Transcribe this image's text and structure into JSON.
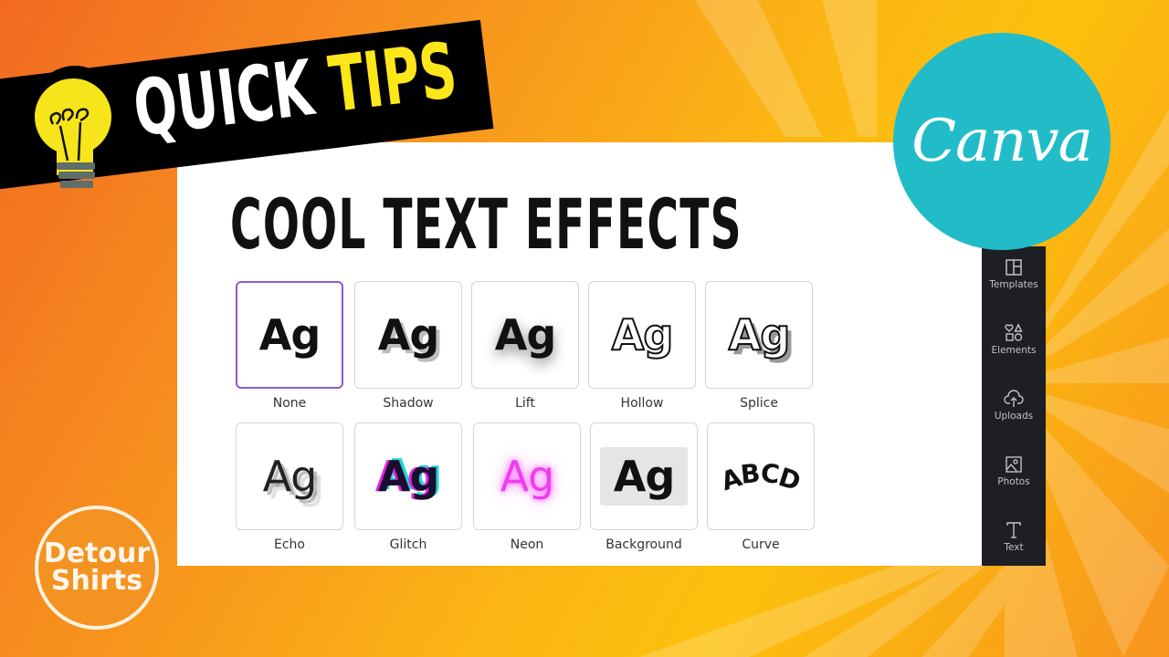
{
  "thumbnail": {
    "banner": {
      "word1": "QUICK",
      "word2": "TIPS"
    },
    "title": "COOL TEXT EFFECTS",
    "brand_logo": "Canva",
    "channel_logo": {
      "line1": "Detour",
      "line2": "Shirts"
    },
    "colors": {
      "accent_selected": "#8b5bd4",
      "canva_teal": "#22bcc9",
      "banner_yellow": "#fde619",
      "sidebar_bg": "#1d1f24",
      "bg_orange": "#f7931e",
      "bg_yellow": "#fdc10d"
    }
  },
  "effects": [
    {
      "label": "None",
      "sample": "Ag",
      "style": "none",
      "selected": true
    },
    {
      "label": "Shadow",
      "sample": "Ag",
      "style": "shadow",
      "selected": false
    },
    {
      "label": "Lift",
      "sample": "Ag",
      "style": "lift",
      "selected": false
    },
    {
      "label": "Hollow",
      "sample": "Ag",
      "style": "hollow",
      "selected": false
    },
    {
      "label": "Splice",
      "sample": "Ag",
      "style": "splice",
      "selected": false
    },
    {
      "label": "Echo",
      "sample": "Ag",
      "style": "echo",
      "selected": false
    },
    {
      "label": "Glitch",
      "sample": "Ag",
      "style": "glitch",
      "selected": false
    },
    {
      "label": "Neon",
      "sample": "Ag",
      "style": "neon",
      "selected": false
    },
    {
      "label": "Background",
      "sample": "Ag",
      "style": "background",
      "selected": false
    },
    {
      "label": "Curve",
      "sample": "ABCD",
      "style": "curve",
      "selected": false
    }
  ],
  "sidebar": {
    "items": [
      {
        "label": "Templates",
        "icon": "templates-icon"
      },
      {
        "label": "Elements",
        "icon": "elements-icon"
      },
      {
        "label": "Uploads",
        "icon": "upload-cloud-icon"
      },
      {
        "label": "Photos",
        "icon": "photo-icon"
      },
      {
        "label": "Text",
        "icon": "text-icon"
      }
    ]
  }
}
